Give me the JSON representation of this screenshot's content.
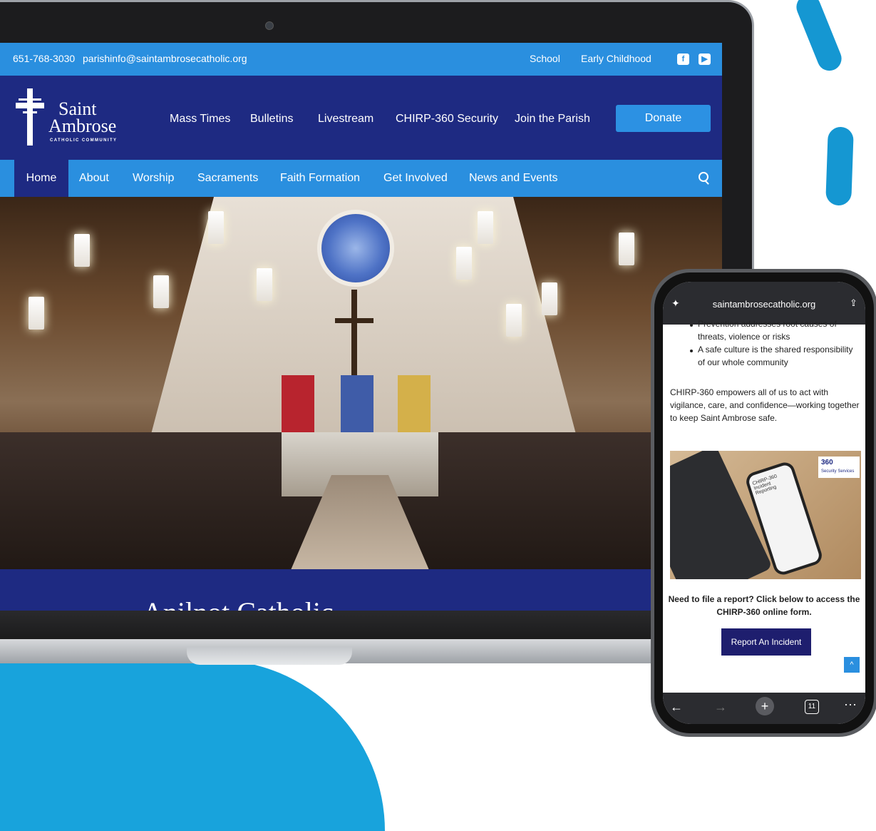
{
  "topbar": {
    "phone": "651-768-3030",
    "email": "parishinfo@saintambrosecatholic.org",
    "links": [
      "School",
      "Early Childhood"
    ],
    "social_icons": [
      "facebook-icon",
      "youtube-icon"
    ]
  },
  "logo": {
    "line1": "Saint",
    "line2": "Ambrose",
    "subtitle": "CATHOLIC COMMUNITY"
  },
  "header_nav": [
    "Mass Times",
    "Bulletins",
    "Livestream",
    "CHIRP-360 Security",
    "Join the Parish"
  ],
  "donate_label": "Donate",
  "main_nav": {
    "active": "Home",
    "items": [
      "About",
      "Worship",
      "Sacraments",
      "Faith Formation",
      "Get Involved",
      "News and Events"
    ]
  },
  "hero_heading_partial": "Anilnot Catholic",
  "phone": {
    "url": "saintambrosecatholic.org",
    "bullets": [
      "Prevention addresses root causes of",
      "threats, violence or risks",
      "A safe culture is the shared responsibility",
      "of our whole community"
    ],
    "paragraph": [
      "CHIRP-360 empowers all of us to act with",
      "vigilance, care, and confidence—working together",
      "to keep Saint Ambrose safe."
    ],
    "image_logo_text": "360",
    "image_logo_sub": "Security Services",
    "image_phone_text": "CHIRP-360 Incident Reporting",
    "cta_line1": "Need to file a report? Click below to access the",
    "cta_line2": "CHIRP-360 online form.",
    "report_button": "Report An Incident",
    "tab_count": "11"
  },
  "colors": {
    "topbar": "#2a8fdf",
    "header": "#1e2a82",
    "donate": "#2c91e3",
    "accent_blob": "#18a3dc"
  }
}
